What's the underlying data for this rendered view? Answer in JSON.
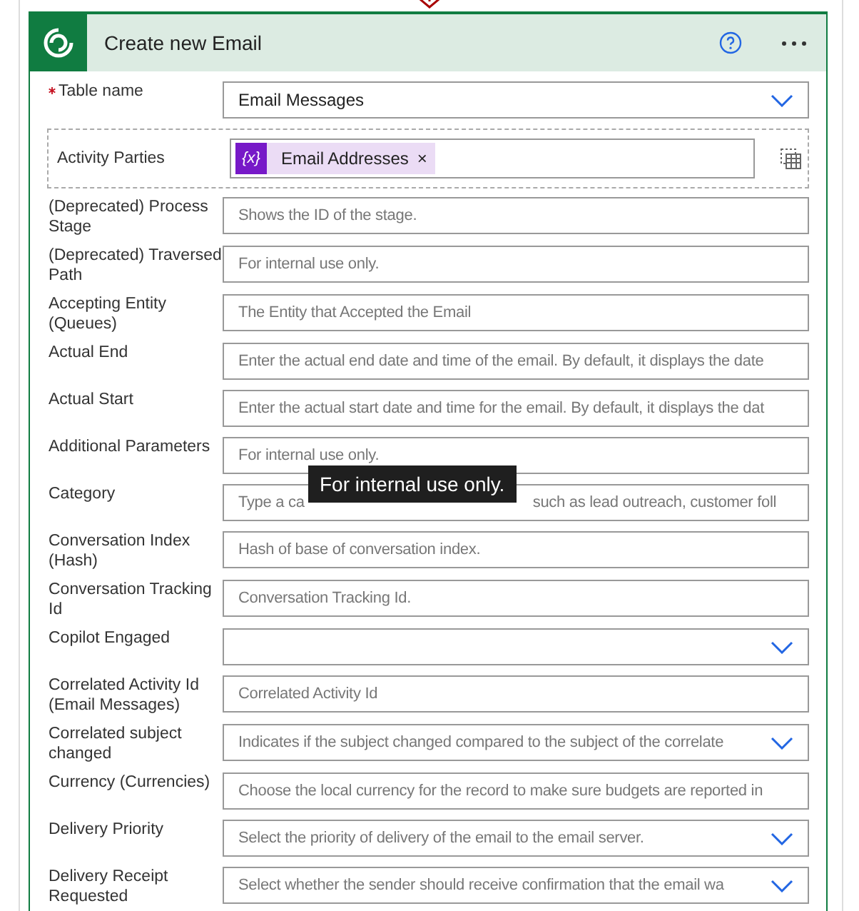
{
  "card": {
    "title": "Create new Email"
  },
  "fields": [
    {
      "kind": "dropdown",
      "label": "Table name",
      "required": true,
      "value": "Email Messages"
    },
    {
      "kind": "token",
      "label": "Activity Parties",
      "required": false,
      "token": "Email Addresses",
      "token_icon": "{x}",
      "remove": "×"
    },
    {
      "kind": "text",
      "label": "(Deprecated) Process Stage",
      "required": false,
      "placeholder": "Shows the ID of the stage."
    },
    {
      "kind": "text",
      "label": "(Deprecated) Traversed Path",
      "required": false,
      "placeholder": "For internal use only."
    },
    {
      "kind": "text",
      "label": "Accepting Entity (Queues)",
      "required": false,
      "placeholder": "The Entity that Accepted the Email"
    },
    {
      "kind": "text",
      "label": "Actual End",
      "required": false,
      "placeholder": "Enter the actual end date and time of the email. By default, it displays the date"
    },
    {
      "kind": "text",
      "label": "Actual Start",
      "required": false,
      "placeholder": "Enter the actual start date and time for the email. By default, it displays the dat"
    },
    {
      "kind": "text",
      "label": "Additional Parameters",
      "required": false,
      "placeholder": "For internal use only."
    },
    {
      "kind": "covered",
      "label": "Category",
      "required": false,
      "placeholder_start": "Type a ca",
      "placeholder_end": "such as lead outreach, customer foll",
      "tooltip": "For internal use only."
    },
    {
      "kind": "text",
      "label": "Conversation Index (Hash)",
      "required": false,
      "placeholder": "Hash of base of conversation index."
    },
    {
      "kind": "text",
      "label": "Conversation Tracking Id",
      "required": false,
      "placeholder": "Conversation Tracking Id."
    },
    {
      "kind": "dropdown",
      "label": "Copilot Engaged",
      "required": false
    },
    {
      "kind": "text",
      "label": "Correlated Activity Id (Email Messages)",
      "required": false,
      "placeholder": "Correlated Activity Id"
    },
    {
      "kind": "dropdown",
      "label": "Correlated subject changed",
      "required": false,
      "placeholder": "Indicates if the subject changed compared to the subject of the correlate"
    },
    {
      "kind": "text",
      "label": "Currency (Currencies)",
      "required": false,
      "placeholder": "Choose the local currency for the record to make sure budgets are reported in"
    },
    {
      "kind": "dropdown",
      "label": "Delivery Priority",
      "required": false,
      "placeholder": "Select the priority of delivery of the email to the email server."
    },
    {
      "kind": "dropdown",
      "label": "Delivery Receipt Requested",
      "required": false,
      "placeholder": "Select whether the sender should receive confirmation that the email wa"
    }
  ]
}
